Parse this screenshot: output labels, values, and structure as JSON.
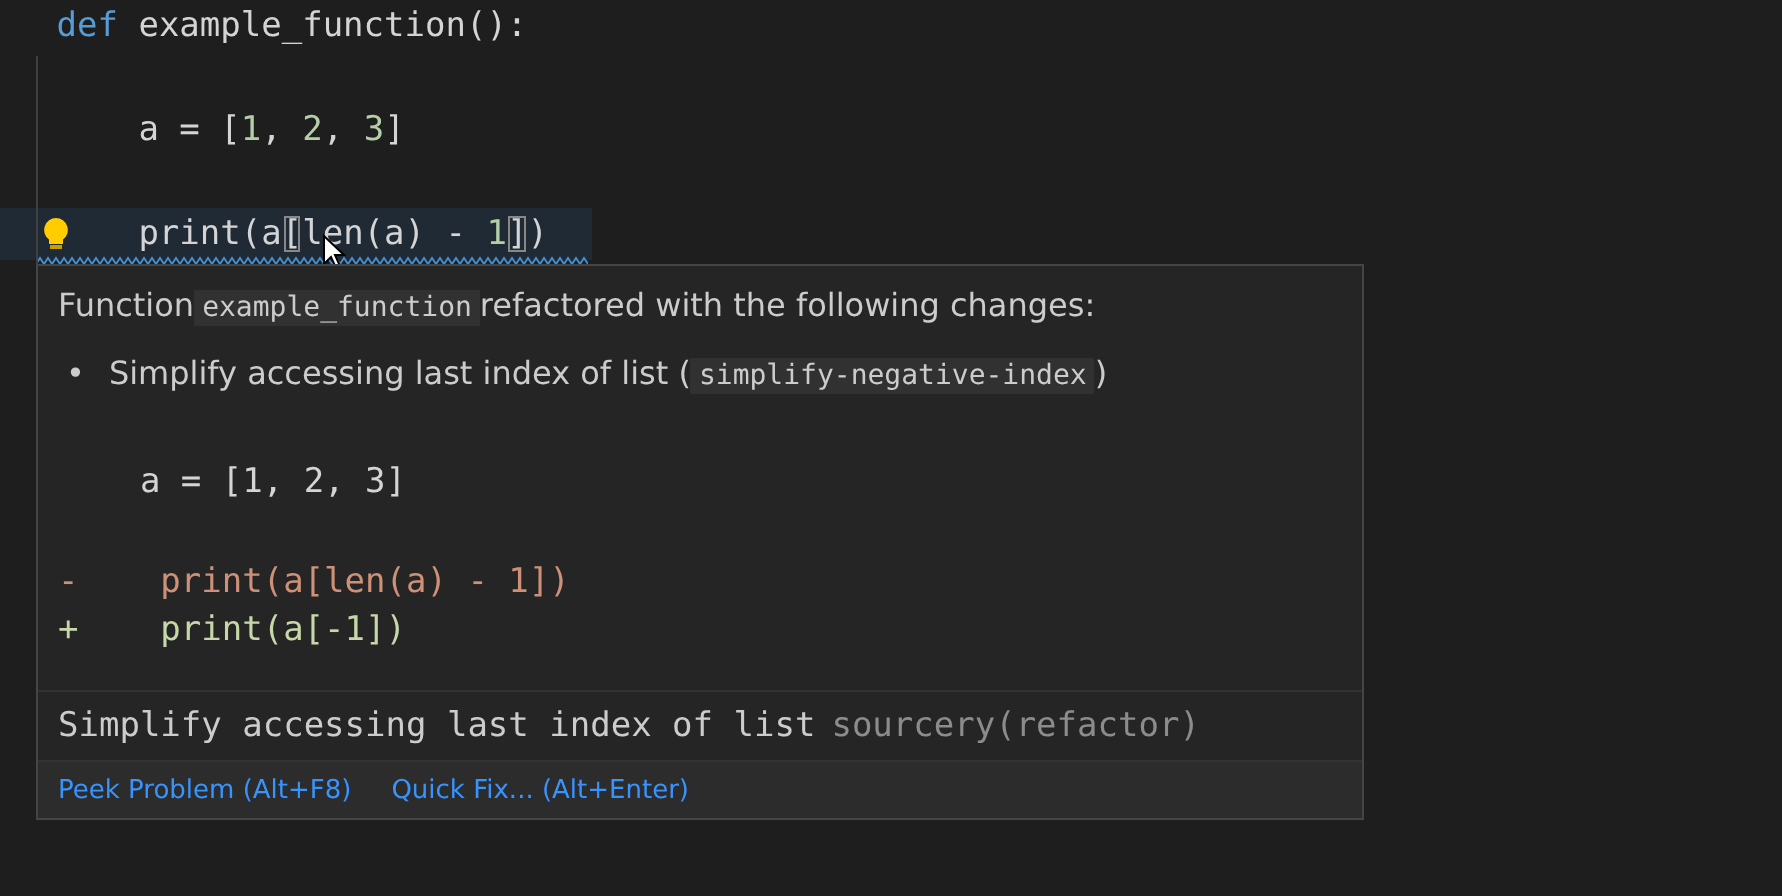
{
  "editor": {
    "lines": [
      {
        "kind": "code",
        "highlighted": false,
        "tokens": [
          {
            "text": "def",
            "kind": "keyword"
          },
          {
            "text": " example_function():",
            "kind": "plain"
          }
        ]
      },
      {
        "kind": "blank"
      },
      {
        "kind": "code",
        "highlighted": false,
        "tokens": [
          {
            "text": "    a = [",
            "kind": "plain"
          },
          {
            "text": "1",
            "kind": "number"
          },
          {
            "text": ", ",
            "kind": "plain"
          },
          {
            "text": "2",
            "kind": "number"
          },
          {
            "text": ", ",
            "kind": "plain"
          },
          {
            "text": "3",
            "kind": "number"
          },
          {
            "text": "]",
            "kind": "plain"
          }
        ]
      },
      {
        "kind": "blank"
      },
      {
        "kind": "code",
        "highlighted": true,
        "tokens": [
          {
            "text": "    print(a",
            "kind": "plain"
          },
          {
            "text": "[",
            "kind": "bracket"
          },
          {
            "text": "len(a) - ",
            "kind": "plain"
          },
          {
            "text": "1",
            "kind": "number"
          },
          {
            "text": "]",
            "kind": "bracket"
          },
          {
            "text": ")",
            "kind": "plain"
          }
        ]
      }
    ]
  },
  "hover": {
    "message": [
      {
        "text": "Function",
        "kind": "text"
      },
      {
        "text": "example_function",
        "kind": "code"
      },
      {
        "text": "refactored with the following changes:",
        "kind": "text"
      }
    ],
    "bullets": [
      {
        "marker": "•",
        "parts": [
          {
            "text": "Simplify accessing last index of list (",
            "kind": "text"
          },
          {
            "text": "simplify-negative-index",
            "kind": "code"
          },
          {
            "text": ")",
            "kind": "text"
          }
        ]
      }
    ],
    "diff": [
      {
        "kind": "context",
        "text": "    a = [1, 2, 3]"
      },
      {
        "kind": "removed",
        "text": "-    print(a[len(a) - 1])"
      },
      {
        "kind": "added",
        "text": "+    print(a[-1])"
      }
    ],
    "problem": {
      "message": "Simplify accessing last index of list",
      "source": "sourcery(refactor)"
    },
    "actions": [
      "Peek Problem (Alt+F8)",
      "Quick Fix... (Alt+Enter)"
    ]
  }
}
